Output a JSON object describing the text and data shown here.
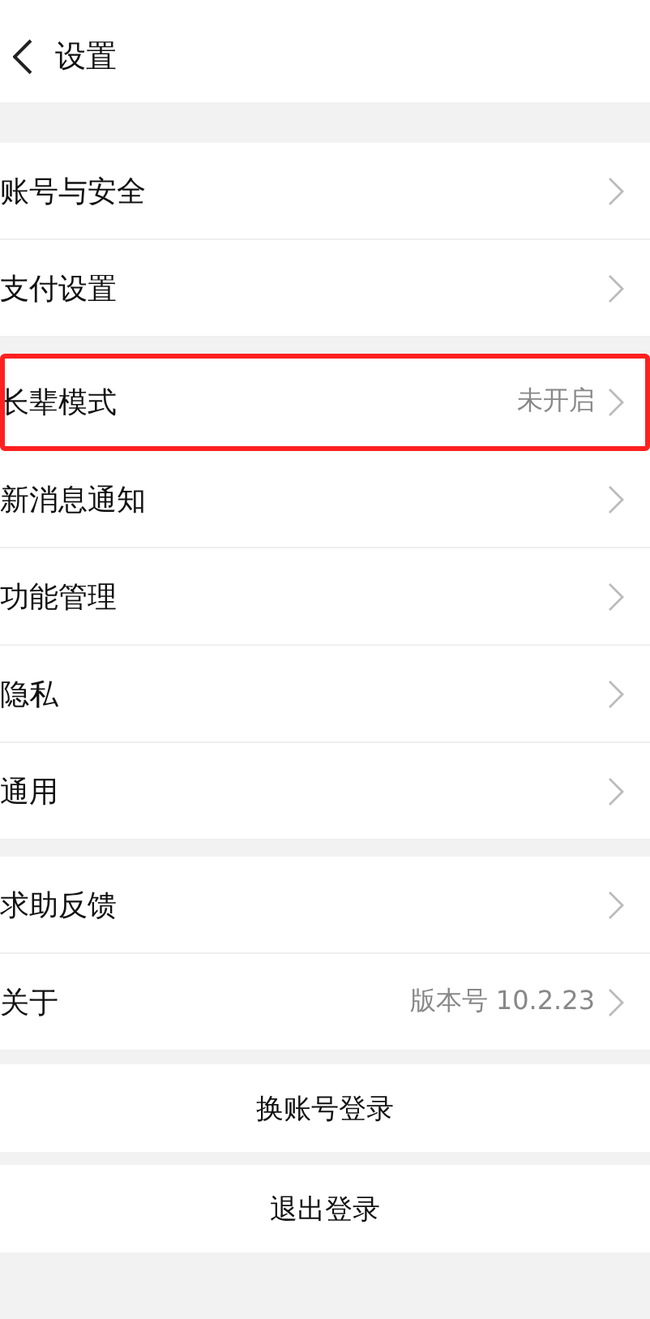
{
  "header": {
    "title": "设置"
  },
  "groups": [
    {
      "items": [
        {
          "label": "账号与安全",
          "highlighted": false
        },
        {
          "label": "支付设置",
          "highlighted": false
        }
      ]
    },
    {
      "items": [
        {
          "label": "长辈模式",
          "value": "未开启",
          "highlighted": true
        },
        {
          "label": "新消息通知",
          "highlighted": false
        },
        {
          "label": "功能管理",
          "highlighted": false
        },
        {
          "label": "隐私",
          "highlighted": false
        },
        {
          "label": "通用",
          "highlighted": false
        }
      ]
    },
    {
      "items": [
        {
          "label": "求助反馈",
          "highlighted": false
        },
        {
          "label": "关于",
          "value": "版本号 10.2.23",
          "highlighted": false
        }
      ]
    }
  ],
  "actions": [
    {
      "label": "换账号登录"
    },
    {
      "label": "退出登录"
    }
  ]
}
